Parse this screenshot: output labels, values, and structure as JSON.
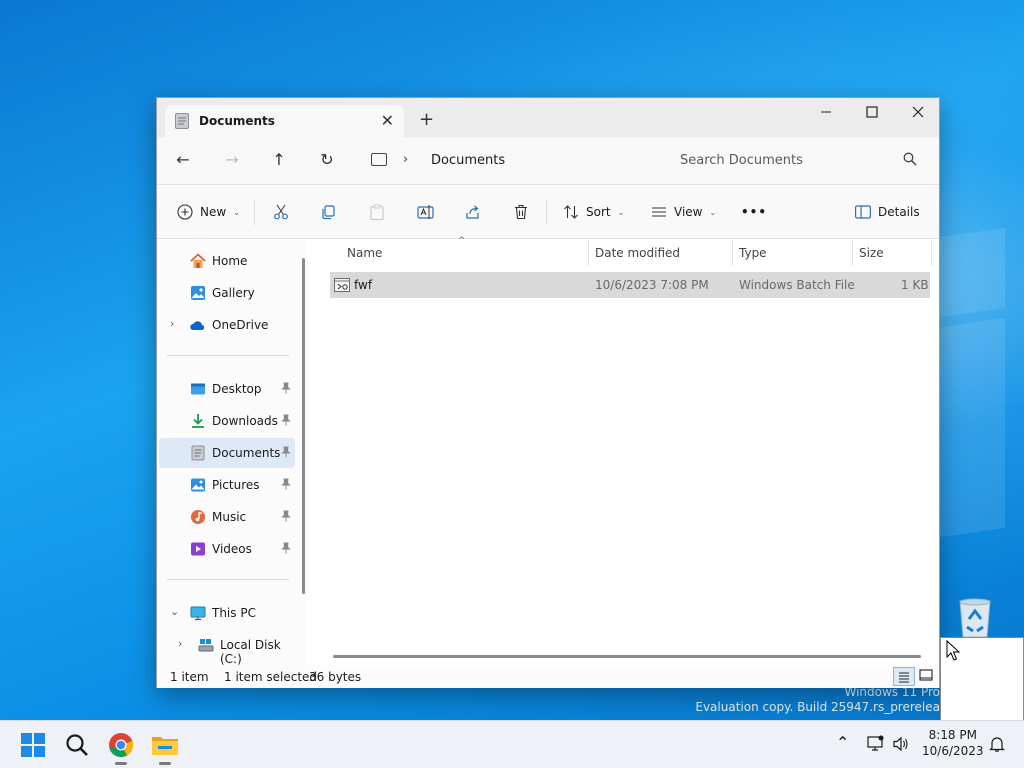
{
  "window": {
    "tab_title": "Documents",
    "new_tab_label": "+",
    "close_tab_label": "✕"
  },
  "caption": {
    "minimize": "—",
    "maximize": "☐",
    "close": "✕"
  },
  "nav": {
    "back": "←",
    "forward": "→",
    "up": "↑",
    "refresh": "↻",
    "breadcrumb_sep": "›",
    "breadcrumb": "Documents",
    "search_placeholder": "Search Documents"
  },
  "toolbar": {
    "new_label": "New",
    "sort_label": "Sort",
    "view_label": "View",
    "more_label": "•••",
    "details_label": "Details"
  },
  "navpane": {
    "home": "Home",
    "gallery": "Gallery",
    "onedrive": "OneDrive",
    "desktop": "Desktop",
    "downloads": "Downloads",
    "documents": "Documents",
    "pictures": "Pictures",
    "music": "Music",
    "videos": "Videos",
    "this_pc": "This PC",
    "local_disk": "Local Disk (C:)"
  },
  "filelist": {
    "columns": {
      "name": "Name",
      "date_modified": "Date modified",
      "type": "Type",
      "size": "Size"
    },
    "rows": [
      {
        "name": "fwf",
        "date_modified": "10/6/2023 7:08 PM",
        "type": "Windows Batch File",
        "size": "1 KB"
      }
    ]
  },
  "status": {
    "count": "1 item",
    "selection": "1 item selected",
    "bytes": "36 bytes"
  },
  "desktop": {
    "watermark_line1": "Windows 11 Pro",
    "watermark_line2": "Evaluation copy. Build 25947.rs_prerelea"
  },
  "taskbar": {
    "clock_time": "8:18 PM",
    "clock_date": "10/6/2023",
    "tray_overflow": "⌃"
  },
  "colors": {
    "accent": "#0067c0",
    "selection": "#dde9f6",
    "row_selected": "#d9d9d9"
  },
  "icons": [
    "documents-icon",
    "home-icon",
    "gallery-icon",
    "onedrive-icon",
    "desktop-icon",
    "downloads-icon",
    "pictures-icon",
    "music-icon",
    "videos-icon",
    "this-pc-icon",
    "local-disk-icon",
    "pin-icon",
    "batch-file-icon",
    "recycle-bin-icon",
    "start-icon",
    "search-icon",
    "chrome-icon",
    "file-explorer-icon",
    "network-icon",
    "volume-icon",
    "bell-icon"
  ]
}
